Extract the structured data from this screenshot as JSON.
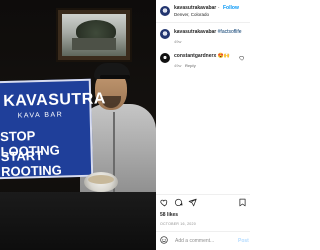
{
  "post": {
    "username": "kavasutrakavabar",
    "location": "Denver, Colorado",
    "follow_label": "Follow",
    "more_label": "•••"
  },
  "caption": {
    "username": "kavasutrakavabar",
    "hashtag": "#factsoflife",
    "time": "49w"
  },
  "comments": [
    {
      "username": "constantgardnerx",
      "emoji": "😍🙌",
      "time": "49w",
      "reply_label": "Reply"
    }
  ],
  "stats": {
    "likes": "58 likes",
    "date": "OCTOBER 16, 2020"
  },
  "comment_box": {
    "placeholder": "Add a comment...",
    "post_label": "Post"
  },
  "sign": {
    "brand": "KAVASUTRA",
    "sub": "KAVA BAR",
    "line1": "STOP LOOTING",
    "line2": "START ROOTING"
  },
  "icons": [
    "emoji-icon",
    "heart-icon",
    "comment-icon",
    "share-icon",
    "bookmark-icon"
  ],
  "colors": {
    "link_blue": "#0095f6",
    "muted": "#8e8e8e",
    "sign_blue": "#1f3f9a"
  }
}
